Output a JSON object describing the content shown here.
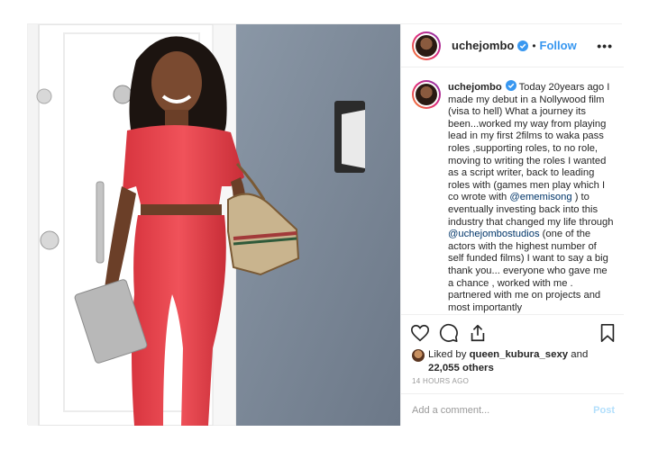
{
  "post": {
    "username": "uchejombo",
    "follow_label": "Follow",
    "dot": "•",
    "more_label": "•••",
    "caption": {
      "username": "uchejombo",
      "part1": " Today 20years ago I made my debut in a Nollywood film (visa to hell) What a journey its been...worked my way from playing lead in my first 2films to waka pass roles ,supporting roles, to no role, moving to writing the roles I wanted as a script writer, back to leading roles with (games men play which I co wrote with ",
      "mention1": "@ememisong",
      "part2": " ) to eventually investing back into this industry that changed my life through ",
      "mention2": "@uchejombostudios",
      "part3": " (one of the actors with the highest number of self funded films) I want to say a big thank you... everyone who gave me a chance , worked with me . partnered with me on projects and most importantly"
    },
    "likes": {
      "prefix": "Liked by ",
      "liker": "queen_kubura_sexy",
      "middle": " and",
      "count": "22,055 others"
    },
    "timestamp": "14 HOURS AGO",
    "comment": {
      "placeholder": "Add a comment...",
      "post_label": "Post"
    },
    "icons": {
      "like": "heart-icon",
      "comment": "comment-icon",
      "share": "share-icon",
      "save": "bookmark-icon",
      "verified": "verified-badge-icon"
    },
    "colors": {
      "accent": "#3897f0",
      "mention": "#003569",
      "outfit": "#e8424a",
      "wall": "#7a8898"
    }
  }
}
